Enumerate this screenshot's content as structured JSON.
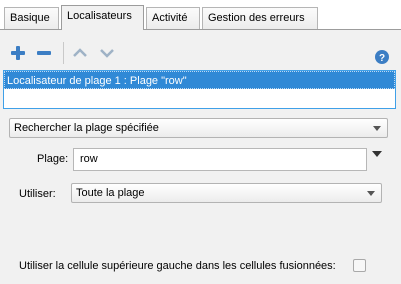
{
  "tabs": [
    {
      "label": "Basique"
    },
    {
      "label": "Localisateurs"
    },
    {
      "label": "Activité"
    },
    {
      "label": "Gestion des erreurs"
    }
  ],
  "active_tab": "Localisateurs",
  "locators": {
    "items": [
      {
        "label": "Localisateur de plage 1 : Plage \"row\""
      }
    ]
  },
  "search_mode": {
    "selected": "Rechercher la plage spécifiée"
  },
  "plage": {
    "label": "Plage:",
    "value": "row"
  },
  "utiliser": {
    "label": "Utiliser:",
    "selected": "Toute la plage"
  },
  "merged": {
    "label": "Utiliser la cellule supérieure gauche dans les cellules fusionnées:",
    "checked": false
  },
  "colors": {
    "accent": "#3089d6",
    "icon_blue": "#3c7ec4",
    "icon_gray": "#9fb2c6"
  }
}
